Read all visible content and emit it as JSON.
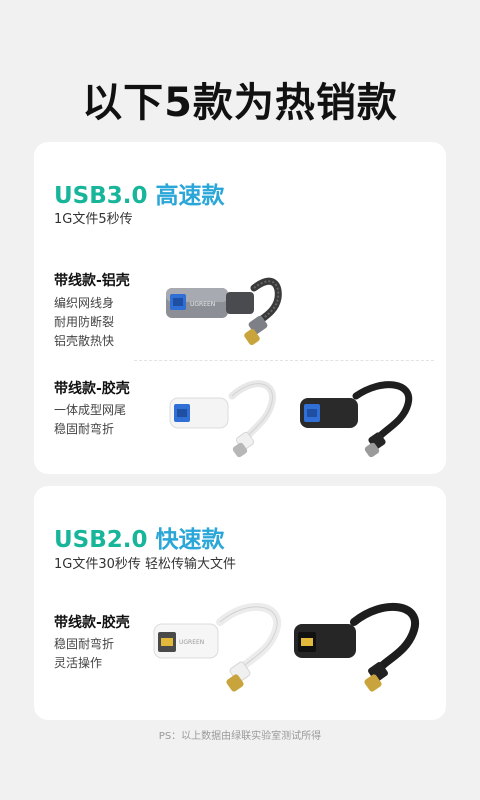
{
  "title": "以下5款为热销款",
  "usb3": {
    "heading_usb": "USB3.0",
    "heading_speed": "高速款",
    "subtitle": "1G文件5秒传",
    "aluminum": {
      "label": "带线款-铝壳",
      "features": [
        "编织网线身",
        "耐用防断裂",
        "铝壳散热快"
      ]
    },
    "rubber": {
      "label": "带线款-胶壳",
      "features": [
        "一体成型网尾",
        "稳固耐弯折"
      ]
    }
  },
  "usb2": {
    "heading_usb": "USB2.0",
    "heading_speed": "快速款",
    "subtitle": "1G文件30秒传 轻松传输大文件",
    "rubber": {
      "label": "带线款-胶壳",
      "features": [
        "稳固耐弯折",
        "灵活操作"
      ]
    }
  },
  "brand_text": "UGREEN",
  "footnote": "PS：以上数据由绿联实验室测试所得",
  "colors": {
    "usb_green": "#17b59a",
    "speed_blue": "#2aa6d8",
    "usb3_port_blue": "#2f6fd6"
  }
}
